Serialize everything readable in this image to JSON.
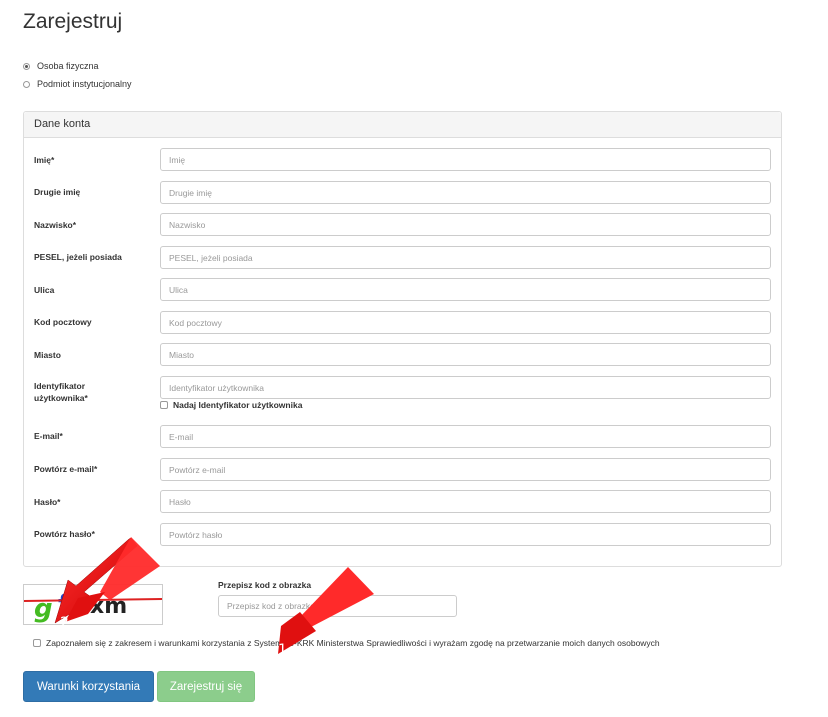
{
  "page": {
    "title": "Zarejestruj"
  },
  "account_type": {
    "options": [
      {
        "label": "Osoba fizyczna",
        "checked": true
      },
      {
        "label": "Podmiot instytucjonalny",
        "checked": false
      }
    ]
  },
  "panel": {
    "heading": "Dane konta",
    "fields": [
      {
        "label": "Imię*",
        "placeholder": "Imię"
      },
      {
        "label": "Drugie imię",
        "placeholder": "Drugie imię"
      },
      {
        "label": "Nazwisko*",
        "placeholder": "Nazwisko"
      },
      {
        "label": "PESEL, jeżeli posiada",
        "placeholder": "PESEL, jeżeli posiada"
      },
      {
        "label": "Ulica",
        "placeholder": "Ulica"
      },
      {
        "label": "Kod pocztowy",
        "placeholder": "Kod pocztowy"
      },
      {
        "label": "Miasto",
        "placeholder": "Miasto"
      },
      {
        "label": "Identyfikator użytkownika*",
        "placeholder": "Identyfikator użytkownika"
      },
      {
        "label": "E-mail*",
        "placeholder": "E-mail"
      },
      {
        "label": "Powtórz e-mail*",
        "placeholder": "Powtórz e-mail"
      },
      {
        "label": "Hasło*",
        "placeholder": "Hasło"
      },
      {
        "label": "Powtórz hasło*",
        "placeholder": "Powtórz hasło"
      }
    ],
    "assign_id_checkbox_label": "Nadaj Identyfikator użytkownika"
  },
  "captcha": {
    "image_text": "gf8xm",
    "label": "Przepisz kod z obrazka",
    "placeholder": "Przepisz kod z obrazka"
  },
  "terms": {
    "checkbox_label": "Zapoznałem się z zakresem i warunkami korzystania z Systemu e-KRK Ministerstwa Sprawiedliwości i wyrażam zgodę na przetwarzanie moich danych osobowych"
  },
  "buttons": {
    "terms_label": "Warunki korzystania",
    "register_label": "Zarejestruj się"
  },
  "annotations": {
    "arrow_1_number": "1",
    "arrow_2_number": "2",
    "arrow_color": "#ee1111"
  }
}
